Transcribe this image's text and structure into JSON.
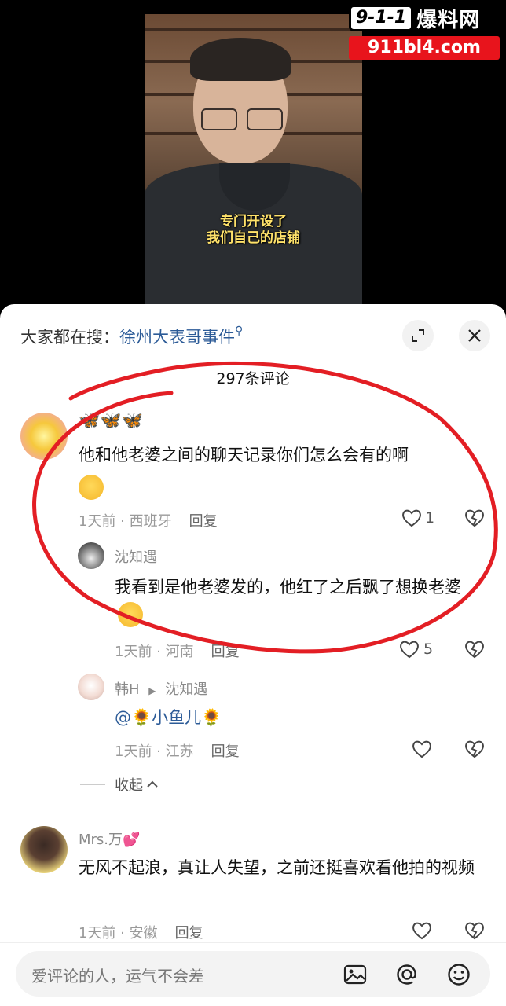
{
  "video": {
    "subtitle_line1": "专门开设了",
    "subtitle_line2": "我们自己的店铺"
  },
  "watermark": {
    "logo_number": "9-1-1",
    "logo_text": "爆料网",
    "url": "911bl4.com"
  },
  "sheet": {
    "search_prefix": "大家都在搜：",
    "search_link": "徐州大表哥事件",
    "comment_count": "297条评论"
  },
  "comments": [
    {
      "username": "🦋🦋🦋",
      "text": "他和他老婆之间的聊天记录你们怎么会有的啊",
      "time_location": "1天前 · 西班牙",
      "reply_label": "回复",
      "likes": "1"
    },
    {
      "username": "沈知遇",
      "text": "我看到是他老婆发的，他红了之后飘了想换老婆",
      "time_location": "1天前 · 河南",
      "reply_label": "回复",
      "likes": "5"
    },
    {
      "username": "韩H",
      "reply_to": "沈知遇",
      "text_prefix": "@",
      "mention": "小鱼儿",
      "time_location": "1天前 · 江苏",
      "reply_label": "回复",
      "likes": ""
    },
    {
      "username": "Mrs.万",
      "text": "无风不起浪，真让人失望，之前还挺喜欢看他拍的视频",
      "time_location": "1天前 · 安徽",
      "reply_label": "回复",
      "likes": ""
    }
  ],
  "collapse_label": "收起",
  "input": {
    "placeholder": "爱评论的人，运气不会差"
  },
  "colors": {
    "link": "#2c5b97",
    "annotation_red": "#e31e24",
    "subtitle": "#ffe26a"
  },
  "icons": [
    "search-icon",
    "expand-icon",
    "close-icon",
    "heart-icon",
    "broken-heart-icon",
    "image-icon",
    "at-icon",
    "emoji-icon",
    "chevron-up-icon"
  ]
}
